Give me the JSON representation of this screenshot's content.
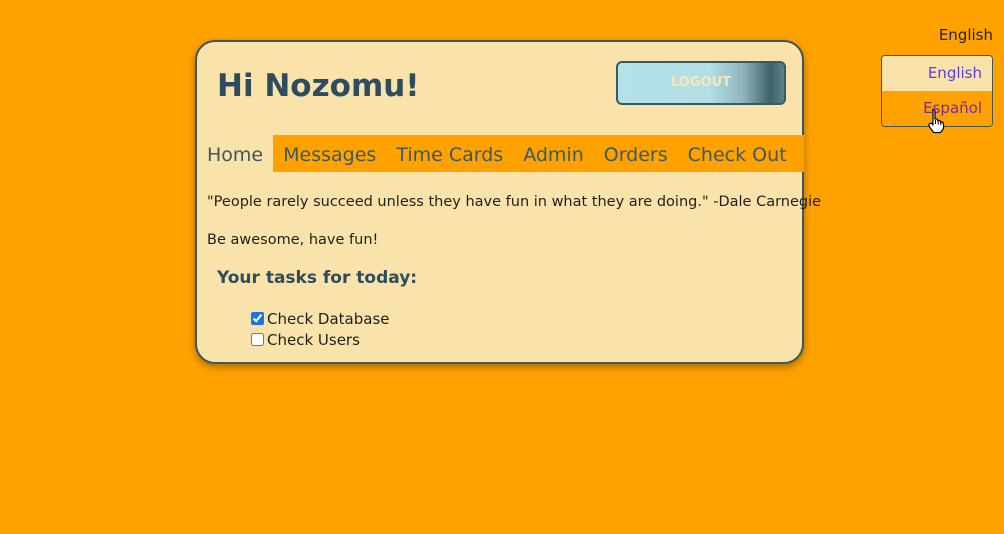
{
  "header": {
    "greeting": "Hi Nozomu!",
    "logout_label": "LOGOUT"
  },
  "nav": {
    "items": [
      "Home",
      "Messages",
      "Time Cards",
      "Admin",
      "Orders",
      "Check Out"
    ],
    "active": "Home"
  },
  "main": {
    "quote": "\"People rarely succeed unless they have fun in what they are doing.\" -Dale Carnegie",
    "motto": "Be awesome, have fun!",
    "tasks_title": "Your tasks for today:",
    "tasks": [
      {
        "label": "Check Database",
        "checked": true
      },
      {
        "label": "Check Users",
        "checked": false
      }
    ]
  },
  "language": {
    "current": "English",
    "options": [
      "English",
      "Español"
    ],
    "hovered": "Español"
  },
  "colors": {
    "background": "#ffa200",
    "card": "#f9e3aa",
    "heading": "#2f4c5f"
  },
  "cursor": "hand-pointer-icon"
}
